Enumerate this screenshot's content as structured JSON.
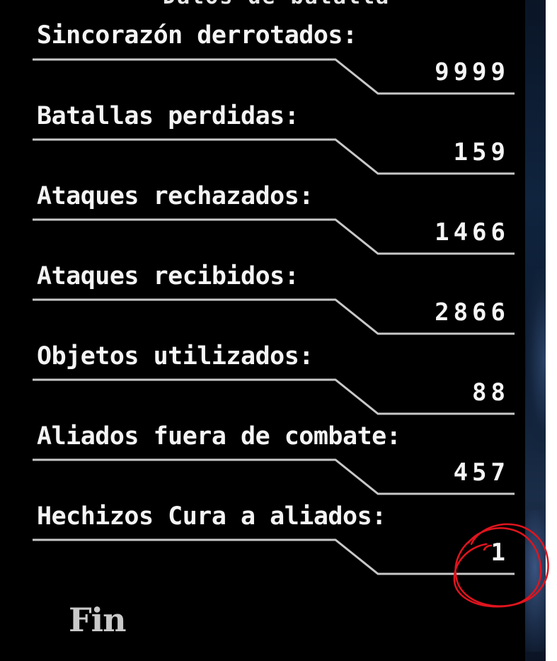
{
  "title": "Datos de batalla",
  "stats": [
    {
      "label": "Sincorazón derrotados:",
      "value": "9999"
    },
    {
      "label": "Batallas perdidas:",
      "value": "159"
    },
    {
      "label": "Ataques rechazados:",
      "value": "1466"
    },
    {
      "label": "Ataques recibidos:",
      "value": "2866"
    },
    {
      "label": "Objetos utilizados:",
      "value": "88"
    },
    {
      "label": "Aliados fuera de combate:",
      "value": "457"
    },
    {
      "label": "Hechizos Cura a aliados:",
      "value": "1"
    }
  ],
  "fin_label": "Fin",
  "colors": {
    "background": "#000000",
    "text": "#f4f4f4",
    "divider": "#c8c8c8",
    "annotation": "#e0141e"
  }
}
